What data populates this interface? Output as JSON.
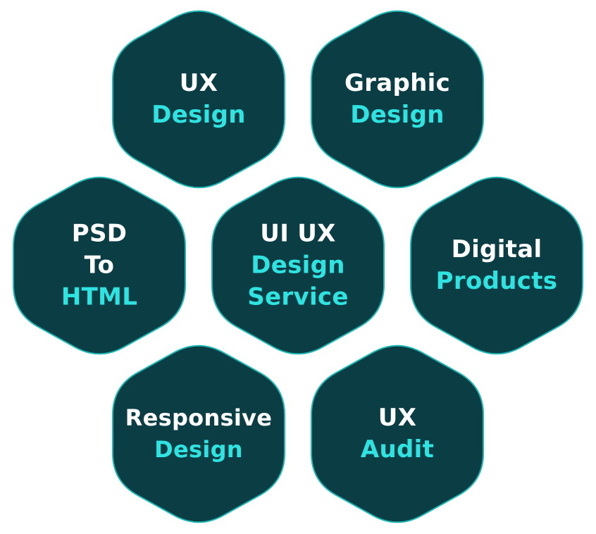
{
  "colors": {
    "hex_fill": "#0b3d45",
    "hex_stroke": "#1fb7b3",
    "text_white": "#ffffff",
    "text_accent": "#2ee3e0"
  },
  "services": [
    {
      "id": "ux-design",
      "lines": [
        {
          "text": "UX",
          "style": "white"
        },
        {
          "text": "Design",
          "style": "accent"
        }
      ]
    },
    {
      "id": "graphic-design",
      "lines": [
        {
          "text": "Graphic",
          "style": "white"
        },
        {
          "text": "Design",
          "style": "accent"
        }
      ]
    },
    {
      "id": "psd-to-html",
      "lines": [
        {
          "text": "PSD",
          "style": "white"
        },
        {
          "text": "To",
          "style": "white"
        },
        {
          "text": "HTML",
          "style": "accent"
        }
      ]
    },
    {
      "id": "ui-ux-design-service",
      "lines": [
        {
          "text": "UI UX",
          "style": "white"
        },
        {
          "text": "Design",
          "style": "accent"
        },
        {
          "text": "Service",
          "style": "accent"
        }
      ]
    },
    {
      "id": "digital-products",
      "lines": [
        {
          "text": "Digital",
          "style": "white"
        },
        {
          "text": "Products",
          "style": "accent"
        }
      ]
    },
    {
      "id": "responsive-design",
      "lines": [
        {
          "text": "Responsive",
          "style": "white"
        },
        {
          "text": "Design",
          "style": "accent"
        }
      ]
    },
    {
      "id": "ux-audit",
      "lines": [
        {
          "text": "UX",
          "style": "white"
        },
        {
          "text": "Audit",
          "style": "accent"
        }
      ]
    }
  ]
}
